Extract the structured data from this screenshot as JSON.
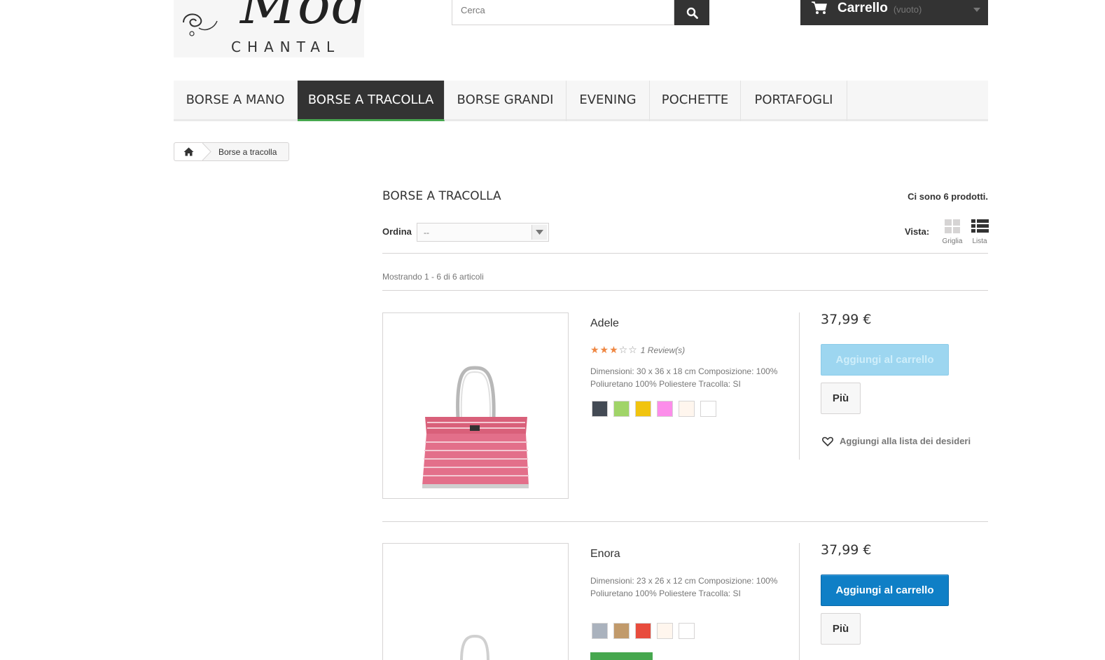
{
  "header": {
    "logo_text": "Mod",
    "logo_sub": "CHANTAL",
    "search_placeholder": "Cerca",
    "cart": {
      "title": "Carrello",
      "status": "(vuoto)"
    }
  },
  "menu": {
    "items": [
      {
        "label": "BORSE A MANO"
      },
      {
        "label": "BORSE A TRACOLLA"
      },
      {
        "label": "BORSE GRANDI"
      },
      {
        "label": "EVENING"
      },
      {
        "label": "POCHETTE"
      },
      {
        "label": "PORTAFOGLI"
      }
    ],
    "active_index": 1
  },
  "breadcrumb": {
    "current": "Borse a tracolla"
  },
  "category": {
    "title": "BORSE A TRACOLLA",
    "count_text": "Ci sono 6 prodotti.",
    "sort_label": "Ordina",
    "sort_value": "--",
    "view_label": "Vista:",
    "view_grid": "Griglia",
    "view_list": "Lista",
    "showing": "Mostrando 1 - 6 di 6 articoli"
  },
  "colors": {
    "accent_blue": "#0f7fc6",
    "dark": "#333333",
    "green": "#46a74e",
    "star": "#ef8743"
  },
  "products": [
    {
      "name": "Adele",
      "rating": 3,
      "rating_max": 5,
      "reviews": "1 Review(s)",
      "description": "Dimensioni: 30 x 36 x 18 cm Composizione: 100% Poliuretano 100% Poliestere Tracolla: SI",
      "swatches": [
        "#434a54",
        "#a0d468",
        "#f1c40f",
        "#fc8dea",
        "#fff6ee",
        "#ffffff"
      ],
      "price": "37,99 €",
      "cart_label": "Aggiungi al carrello",
      "cart_disabled": true,
      "more_label": "Più",
      "wishlist_label": "Aggiungi alla lista dei desideri"
    },
    {
      "name": "Enora",
      "description": "Dimensioni: 23 x 26 x 12 cm   Composizione: 100% Poliuretano 100% Poliestere   Tracolla: SI",
      "swatches": [
        "#aab2bd",
        "#c19a6b",
        "#e84c3d",
        "#fff6ee",
        "#ffffff"
      ],
      "price": "37,99 €",
      "cart_label": "Aggiungi al carrello",
      "cart_disabled": false,
      "more_label": "Più"
    }
  ]
}
